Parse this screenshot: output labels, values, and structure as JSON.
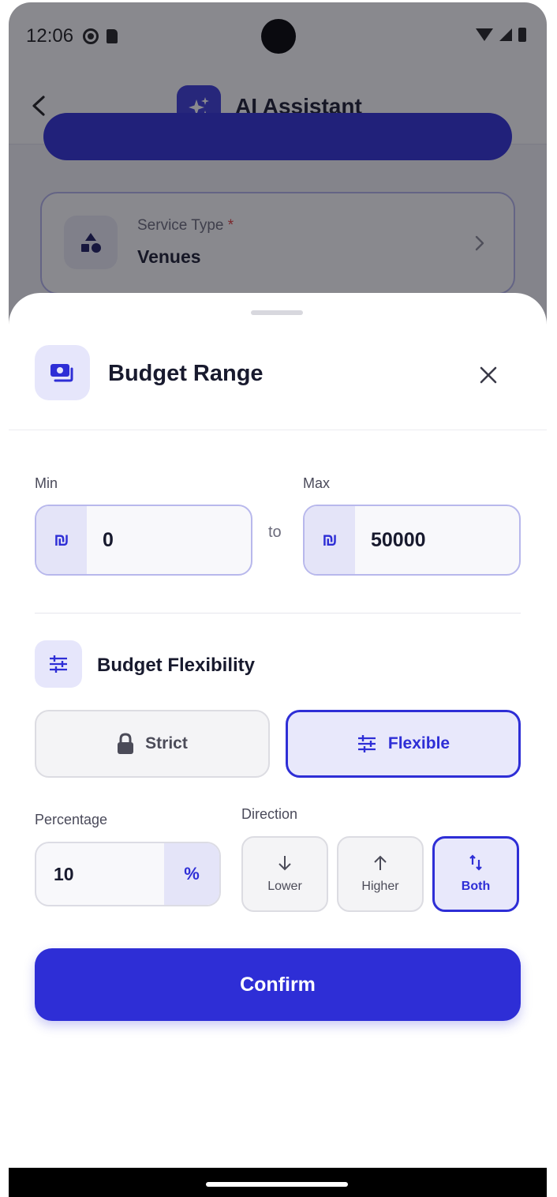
{
  "status_bar": {
    "time": "12:06"
  },
  "app_bar": {
    "title": "AI Assistant"
  },
  "background": {
    "service_card": {
      "label": "Service Type",
      "required_mark": "*",
      "value": "Venues"
    }
  },
  "sheet": {
    "title": "Budget Range",
    "min": {
      "label": "Min",
      "currency": "₪",
      "value": "0"
    },
    "to_label": "to",
    "max": {
      "label": "Max",
      "currency": "₪",
      "value": "50000"
    },
    "flexibility": {
      "title": "Budget Flexibility",
      "options": [
        {
          "label": "Strict",
          "icon": "lock-icon",
          "selected": false
        },
        {
          "label": "Flexible",
          "icon": "sliders-icon",
          "selected": true
        }
      ]
    },
    "percentage": {
      "label": "Percentage",
      "value": "10",
      "suffix": "%"
    },
    "direction": {
      "label": "Direction",
      "options": [
        {
          "label": "Lower",
          "icon": "arrow-down-icon",
          "selected": false
        },
        {
          "label": "Higher",
          "icon": "arrow-up-icon",
          "selected": false
        },
        {
          "label": "Both",
          "icon": "arrows-up-down-icon",
          "selected": true
        }
      ]
    },
    "confirm_label": "Confirm"
  },
  "colors": {
    "accent": "#2e2ed6",
    "accent_light": "#e8e8fb",
    "text_primary": "#181a2e",
    "required": "#e23a3a"
  }
}
